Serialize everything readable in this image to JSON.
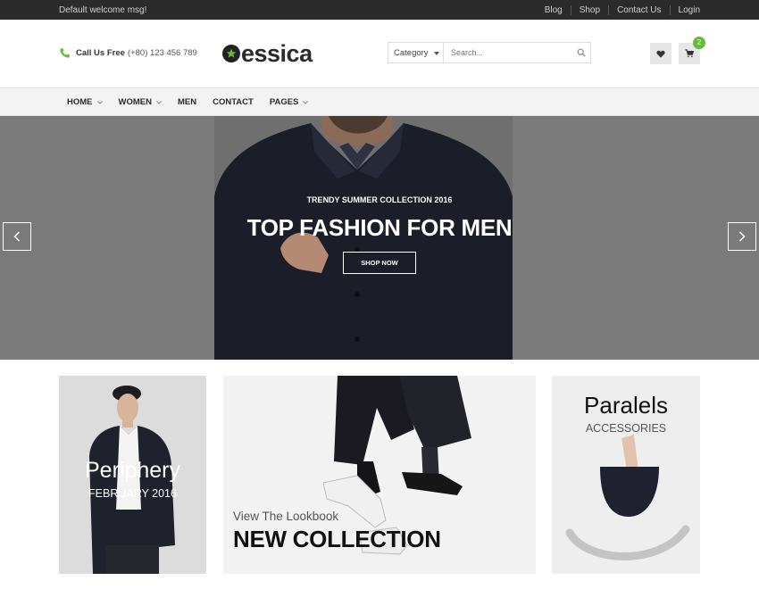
{
  "topbar": {
    "welcome": "Default welcome msg!",
    "links": [
      "Blog",
      "Shop",
      "Contact Us",
      "Login"
    ]
  },
  "header": {
    "call_label": "Call Us Free",
    "call_number": "(+80) 123 456 789",
    "logo_text": "essica",
    "search": {
      "category": "Category",
      "placeholder": "Search..."
    },
    "cart_count": "2"
  },
  "nav": {
    "items": [
      {
        "label": "HOME",
        "has_dropdown": true
      },
      {
        "label": "WOMEN",
        "has_dropdown": true
      },
      {
        "label": "MEN",
        "has_dropdown": false
      },
      {
        "label": "CONTACT",
        "has_dropdown": false
      },
      {
        "label": "PAGES",
        "has_dropdown": true
      }
    ]
  },
  "hero": {
    "subtitle": "TRENDY SUMMER COLLECTION 2016",
    "title": "TOP FASHION FOR MEN",
    "button": "SHOP NOW"
  },
  "banners": {
    "left": {
      "title": "Periphery",
      "subtitle": "FEBRUARY 2016"
    },
    "middle": {
      "kicker": "View The Lookbook",
      "title": "NEW COLLECTION"
    },
    "right": {
      "title": "Paralels",
      "subtitle": "ACCESSORIES"
    }
  },
  "colors": {
    "accent": "#66bb3a",
    "topbar": "#2b2b2b",
    "nav_bg": "#f3f3f3"
  },
  "icons": [
    "phone-icon",
    "logo-star-icon",
    "search-icon",
    "heart-icon",
    "cart-icon",
    "chevron-left-icon",
    "chevron-right-icon"
  ]
}
